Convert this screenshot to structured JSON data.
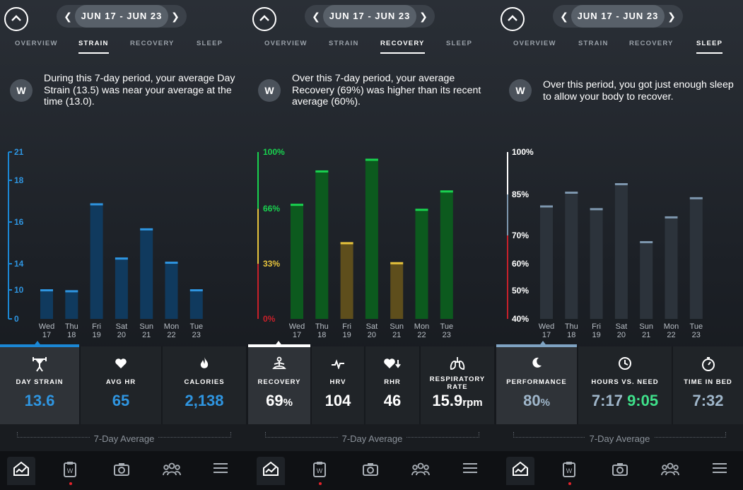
{
  "panels": [
    {
      "date_range": "JUN 17 - JUN 23",
      "tabs": [
        "OVERVIEW",
        "STRAIN",
        "RECOVERY",
        "SLEEP"
      ],
      "active_tab": 1,
      "insight": "During this 7-day period, your average Day Strain (13.5) was near your average at the time (13.0).",
      "accent_color": "#1b87d4",
      "metrics": [
        {
          "label": "DAY STRAIN",
          "value": "13.6",
          "unit": "",
          "icon": "weightlifter-icon",
          "color": "#2f95e0"
        },
        {
          "label": "AVG HR",
          "value": "65",
          "unit": "",
          "icon": "heart-icon",
          "color": "#2f95e0"
        },
        {
          "label": "CALORIES",
          "value": "2,138",
          "unit": "",
          "icon": "flame-icon",
          "color": "#2f95e0"
        }
      ],
      "avg_label": "7-Day Average"
    },
    {
      "date_range": "JUN 17 - JUN 23",
      "tabs": [
        "OVERVIEW",
        "STRAIN",
        "RECOVERY",
        "SLEEP"
      ],
      "active_tab": 2,
      "insight": "Over this 7-day period, your average Recovery (69%) was higher than its recent average (60%).",
      "accent_color": "#ffffff",
      "metrics": [
        {
          "label": "RECOVERY",
          "value": "69",
          "unit": "%",
          "icon": "meditation-icon",
          "color": "#ffffff"
        },
        {
          "label": "HRV",
          "value": "104",
          "unit": "",
          "icon": "pulse-icon",
          "color": "#ffffff"
        },
        {
          "label": "RHR",
          "value": "46",
          "unit": "",
          "icon": "heart-down-icon",
          "color": "#ffffff"
        },
        {
          "label": "RESPIRATORY RATE",
          "value": "15.9",
          "unit": "rpm",
          "icon": "lungs-icon",
          "color": "#ffffff"
        }
      ],
      "avg_label": "7-Day Average"
    },
    {
      "date_range": "JUN 17 - JUN 23",
      "tabs": [
        "OVERVIEW",
        "STRAIN",
        "RECOVERY",
        "SLEEP"
      ],
      "active_tab": 3,
      "insight": "Over this period, you got just enough sleep to allow your body to recover.",
      "accent_color": "#7fa3c2",
      "metrics": [
        {
          "label": "PERFORMANCE",
          "value": "80",
          "unit": "%",
          "icon": "moon-icon",
          "color": "#9fb6ca"
        },
        {
          "label": "HOURS VS. NEED",
          "value": "7:17",
          "value2": "9:05",
          "unit": "",
          "icon": "clock-icon",
          "color": "#9fb6ca",
          "color2": "#3fe08a"
        },
        {
          "label": "TIME IN BED",
          "value": "7:32",
          "unit": "",
          "icon": "stopwatch-icon",
          "color": "#9fb6ca"
        }
      ],
      "avg_label": "7-Day Average"
    }
  ],
  "chart_data": [
    {
      "type": "bar",
      "title": "",
      "categories": [
        "Wed 17",
        "Thu 18",
        "Fri 19",
        "Sat 20",
        "Sun 21",
        "Mon 22",
        "Tue 23"
      ],
      "values": [
        10.1,
        9.9,
        16.9,
        14.3,
        15.7,
        14.1,
        10.1
      ],
      "y_ticks": [
        "0",
        "10",
        "14",
        "16",
        "18",
        "21"
      ],
      "ylim": [
        0,
        21
      ],
      "bar_color": "#103a5e",
      "cap_color": "#2f95e0"
    },
    {
      "type": "bar",
      "title": "",
      "categories": [
        "Wed 17",
        "Thu 18",
        "Fri 19",
        "Sat 20",
        "Sun 21",
        "Mon 22",
        "Tue 23"
      ],
      "values": [
        69,
        89,
        46,
        96,
        34,
        66,
        77
      ],
      "y_ticks": [
        "0%",
        "33%",
        "66%",
        "100%"
      ],
      "ylim": [
        0,
        100
      ],
      "zones": [
        {
          "from": 0,
          "to": 33,
          "color": "#c8202a"
        },
        {
          "from": 33,
          "to": 66,
          "color": "#e6c33d"
        },
        {
          "from": 66,
          "to": 100,
          "color": "#19d14f"
        }
      ]
    },
    {
      "type": "bar",
      "title": "",
      "categories": [
        "Wed 17",
        "Thu 18",
        "Fri 19",
        "Sat 20",
        "Sun 21",
        "Mon 22",
        "Tue 23"
      ],
      "values": [
        81,
        86,
        80,
        89,
        68,
        77,
        84
      ],
      "y_ticks": [
        "40%",
        "50%",
        "60%",
        "70%",
        "85%",
        "100%"
      ],
      "ylim": [
        40,
        100
      ],
      "bar_color": "#2c333b",
      "cap_color": "#7d96ad"
    }
  ],
  "nav": [
    "home-icon",
    "journal-icon",
    "camera-icon",
    "team-icon",
    "menu-icon"
  ]
}
